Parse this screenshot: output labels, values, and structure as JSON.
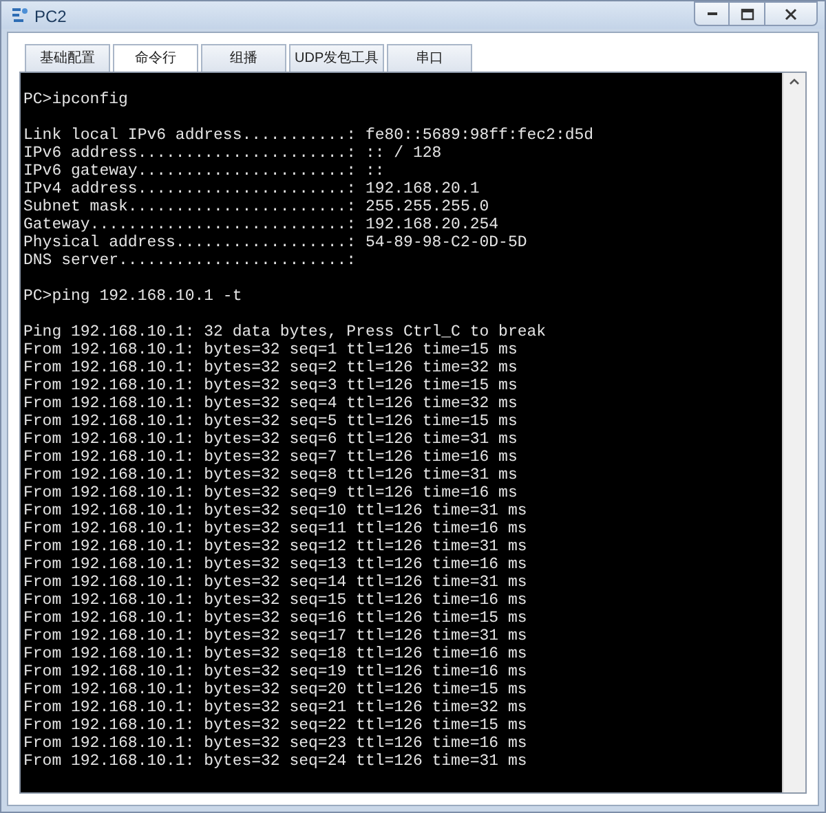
{
  "window": {
    "title": "PC2",
    "controls": [
      {
        "kind": "minimize"
      },
      {
        "kind": "maximize"
      },
      {
        "kind": "close"
      }
    ]
  },
  "tabs": [
    {
      "label": "基础配置",
      "selected": false
    },
    {
      "label": "命令行",
      "selected": true
    },
    {
      "label": "组播",
      "selected": false
    },
    {
      "label": "UDP发包工具",
      "selected": false
    },
    {
      "label": "串口",
      "selected": false
    }
  ],
  "terminal": {
    "blocks": [
      [
        "PC>ipconfig"
      ],
      [
        "Link local IPv6 address...........: fe80::5689:98ff:fec2:d5d",
        "IPv6 address......................: :: / 128",
        "IPv6 gateway......................: ::",
        "IPv4 address......................: 192.168.20.1",
        "Subnet mask.......................: 255.255.255.0",
        "Gateway...........................: 192.168.20.254",
        "Physical address..................: 54-89-98-C2-0D-5D",
        "DNS server........................:"
      ],
      [
        "PC>ping 192.168.10.1 -t"
      ],
      [
        "Ping 192.168.10.1: 32 data bytes, Press Ctrl_C to break",
        "From 192.168.10.1: bytes=32 seq=1 ttl=126 time=15 ms",
        "From 192.168.10.1: bytes=32 seq=2 ttl=126 time=32 ms",
        "From 192.168.10.1: bytes=32 seq=3 ttl=126 time=15 ms",
        "From 192.168.10.1: bytes=32 seq=4 ttl=126 time=32 ms",
        "From 192.168.10.1: bytes=32 seq=5 ttl=126 time=15 ms",
        "From 192.168.10.1: bytes=32 seq=6 ttl=126 time=31 ms",
        "From 192.168.10.1: bytes=32 seq=7 ttl=126 time=16 ms",
        "From 192.168.10.1: bytes=32 seq=8 ttl=126 time=31 ms",
        "From 192.168.10.1: bytes=32 seq=9 ttl=126 time=16 ms",
        "From 192.168.10.1: bytes=32 seq=10 ttl=126 time=31 ms",
        "From 192.168.10.1: bytes=32 seq=11 ttl=126 time=16 ms",
        "From 192.168.10.1: bytes=32 seq=12 ttl=126 time=31 ms",
        "From 192.168.10.1: bytes=32 seq=13 ttl=126 time=16 ms",
        "From 192.168.10.1: bytes=32 seq=14 ttl=126 time=31 ms",
        "From 192.168.10.1: bytes=32 seq=15 ttl=126 time=16 ms",
        "From 192.168.10.1: bytes=32 seq=16 ttl=126 time=15 ms",
        "From 192.168.10.1: bytes=32 seq=17 ttl=126 time=31 ms",
        "From 192.168.10.1: bytes=32 seq=18 ttl=126 time=16 ms",
        "From 192.168.10.1: bytes=32 seq=19 ttl=126 time=16 ms",
        "From 192.168.10.1: bytes=32 seq=20 ttl=126 time=15 ms",
        "From 192.168.10.1: bytes=32 seq=21 ttl=126 time=32 ms",
        "From 192.168.10.1: bytes=32 seq=22 ttl=126 time=15 ms",
        "From 192.168.10.1: bytes=32 seq=23 ttl=126 time=16 ms",
        "From 192.168.10.1: bytes=32 seq=24 ttl=126 time=31 ms"
      ]
    ]
  }
}
